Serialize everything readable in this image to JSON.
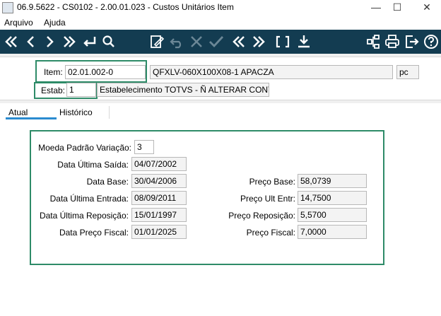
{
  "window": {
    "title": "06.9.5622 - CS0102 - 2.00.01.023 - Custos Unitários Item",
    "minimize": "—",
    "maximize": "☐",
    "close": "✕"
  },
  "menu": [
    "Arquivo",
    "Ajuda"
  ],
  "toolbar": {
    "left": [
      "first-icon",
      "prev-icon",
      "next-icon",
      "last-icon",
      "goto-icon",
      "search-icon"
    ],
    "middle": [
      "edit-icon",
      "undo-icon",
      "cancel-icon",
      "confirm-icon",
      "prev-set-icon",
      "next-set-icon",
      "bracket-icon",
      "download-icon"
    ],
    "right": [
      "structure-icon",
      "print-icon",
      "exit-icon",
      "help-icon"
    ]
  },
  "header": {
    "item_label": "Item:",
    "item_code": "02.01.002-0",
    "item_desc": "QFXLV-060X100X08-1 APACZA",
    "item_unit": "pc",
    "estab_label": "Estab:",
    "estab_code": "1",
    "estab_desc": "Estabelecimento TOTVS - Ñ ALTERAR CONTAS"
  },
  "tabs": [
    {
      "label": "Atual",
      "active": true
    },
    {
      "label": "Histórico",
      "active": false
    }
  ],
  "fields": {
    "moeda_label": "Moeda Padrão Variação:",
    "moeda_value": "3",
    "ult_saida_label": "Data Última Saída:",
    "ult_saida_value": "04/07/2002",
    "data_base_label": "Data Base:",
    "data_base_value": "30/04/2006",
    "ult_entrada_label": "Data Última Entrada:",
    "ult_entrada_value": "08/09/2011",
    "ult_repos_label": "Data Última Reposição:",
    "ult_repos_value": "15/01/1997",
    "preco_fiscal_data_label": "Data Preço Fiscal:",
    "preco_fiscal_data_value": "01/01/2025",
    "preco_base_label": "Preço Base:",
    "preco_base_value": "58,0739",
    "preco_ult_entr_label": "Preço Ult Entr:",
    "preco_ult_entr_value": "14,7500",
    "preco_repos_label": "Preço Reposição:",
    "preco_repos_value": "5,5700",
    "preco_fiscal_label": "Preço Fiscal:",
    "preco_fiscal_value": "7,0000"
  },
  "colors": {
    "toolbar": "#133c51",
    "highlight": "#2e8b68",
    "tab_accent": "#2a8bd0"
  }
}
